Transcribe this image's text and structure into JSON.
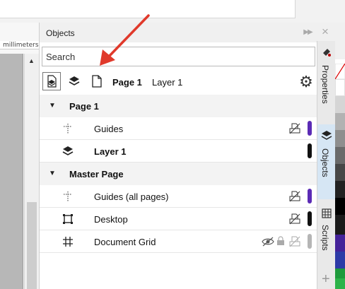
{
  "ruler": {
    "units": "millimeters"
  },
  "panel": {
    "title": "Objects",
    "search_placeholder": "Search",
    "toolbar": {
      "current_page": "Page 1",
      "current_layer": "Layer 1"
    },
    "tree": {
      "page1": {
        "label": "Page 1",
        "guides": "Guides",
        "layer": "Layer 1"
      },
      "master": {
        "label": "Master Page",
        "guides": "Guides (all pages)",
        "desktop": "Desktop",
        "grid": "Document Grid"
      }
    },
    "colors": {
      "guides": "#5b2bb5",
      "layer": "#111111",
      "desktop": "#111111",
      "grid": "#b5b5b5"
    }
  },
  "side_tabs": {
    "properties": "Properties",
    "objects": "Objects",
    "scripts": "Scripts"
  },
  "annotation": {
    "arrow_color": "#e0392b"
  }
}
